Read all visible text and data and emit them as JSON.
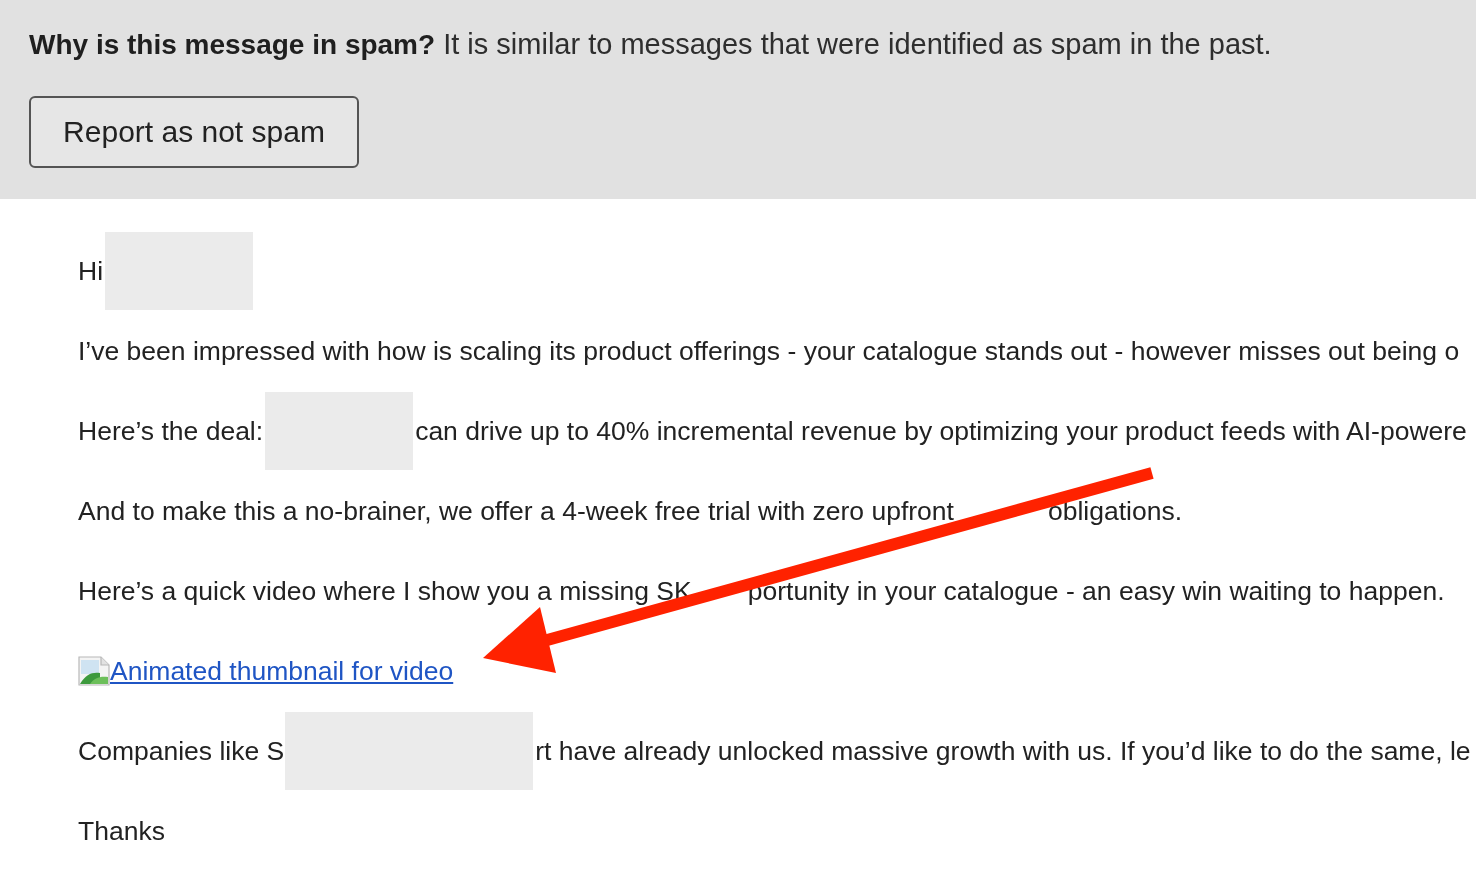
{
  "spam_banner": {
    "text": "**Why is this message in spam?** It is similar to messages that were identified as spam in the past.",
    "button": "Report as not spam"
  },
  "message": {
    "lines": [
      {
        "parts": [
          {
            "kind": "text",
            "text": "Hi"
          },
          {
            "kind": "redaction"
          }
        ]
      },
      {
        "parts": [
          {
            "kind": "text",
            "text": "I’ve been impressed with how is scaling its product offerings - your catalogue stands out - however misses out being o"
          }
        ]
      },
      {
        "parts": [
          {
            "kind": "text",
            "text": "Here’s the deal:"
          },
          {
            "kind": "redaction"
          },
          {
            "kind": "text",
            "text": "can drive up to 40% incremental revenue by optimizing your product feeds with AI-powere"
          }
        ]
      },
      {
        "parts": [
          {
            "kind": "text",
            "text": "And to make this a no-brainer, we offer a 4-week free trial with zero upfront"
          },
          {
            "kind": "covered_wide"
          },
          {
            "kind": "text",
            "text": "obligations."
          }
        ]
      },
      {
        "parts": [
          {
            "kind": "text",
            "text": "Here’s a quick video where I show you a missing SK"
          },
          {
            "kind": "covered"
          },
          {
            "kind": "text",
            "text": "portunity in your catalogue - an easy win waiting to happen."
          }
        ]
      },
      {
        "parts": [
          {
            "kind": "link",
            "text": "Animated thumbnail for video"
          }
        ]
      },
      {
        "parts": [
          {
            "kind": "text",
            "text": "Companies like S"
          },
          {
            "kind": "redaction_wide"
          },
          {
            "kind": "text",
            "text": "rt have already unlocked massive growth with us. If you’d like to do the same, le"
          }
        ]
      },
      {
        "parts": [
          {
            "kind": "text",
            "text": "Thanks"
          }
        ]
      }
    ]
  }
}
